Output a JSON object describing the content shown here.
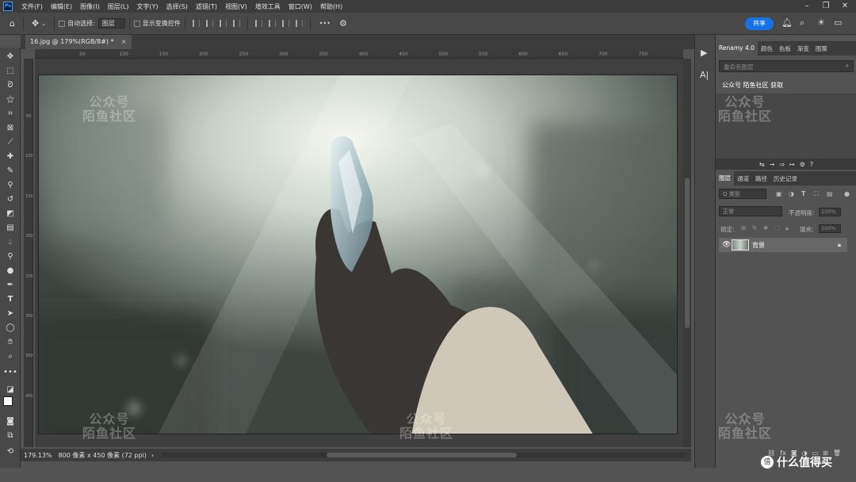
{
  "menu": {
    "items": [
      "文件(F)",
      "编辑(E)",
      "图像(I)",
      "图层(L)",
      "文字(Y)",
      "选择(S)",
      "滤镜(T)",
      "视图(V)",
      "增效工具",
      "窗口(W)",
      "帮助(H)"
    ]
  },
  "options_bar": {
    "auto_select_label": "自动选择:",
    "auto_select_value": "图层",
    "show_transform_label": "显示变换控件",
    "more_label": "•••",
    "share_label": "共享"
  },
  "document": {
    "tab_title": "16.jpg @ 179%(RGB/8#) *",
    "close_glyph": "×",
    "ruler_h_labels": [
      "50",
      "100",
      "150",
      "200",
      "250",
      "300",
      "350",
      "400",
      "450",
      "500",
      "550",
      "600",
      "650",
      "700",
      "750"
    ],
    "ruler_v_labels": [
      "50",
      "100",
      "150",
      "200",
      "250",
      "300",
      "350",
      "400"
    ]
  },
  "status": {
    "zoom": "179.13%",
    "size": "800 像素 x 450 像素 (72 ppi)"
  },
  "panel": {
    "renamy_tabs": [
      "Renamy 4.0",
      "颜色",
      "色板",
      "渐变",
      "图案"
    ],
    "renamy_placeholder": "重命名图层",
    "renamy_item": "公众号 陌鱼社区 获取",
    "layer_tabs": [
      "图层",
      "通道",
      "路径",
      "历史记录"
    ],
    "filter_label": "Q 类型",
    "blend_mode": "正常",
    "opacity_label": "不透明度:",
    "opacity_value": "100%",
    "lock_label": "锁定:",
    "fill_label": "填充:",
    "fill_value": "100%",
    "layer_name": "背景"
  },
  "watermark": {
    "line1": "公众号",
    "line2": "陌鱼社区"
  },
  "brand": {
    "text": "什么值得买",
    "logo": "值"
  }
}
